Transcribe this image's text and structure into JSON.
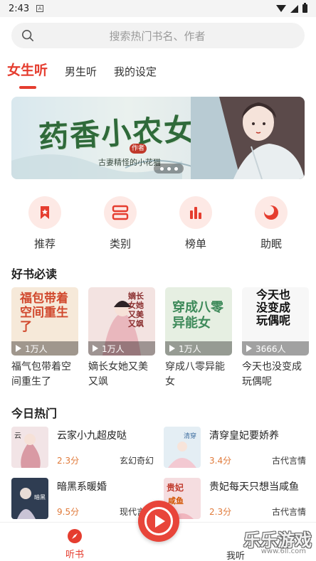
{
  "status_bar": {
    "time": "2:43",
    "sim_label": "A"
  },
  "search": {
    "placeholder": "搜索热门书名、作者"
  },
  "tabs": [
    {
      "label": "女生听",
      "active": true
    },
    {
      "label": "男生听",
      "active": false
    },
    {
      "label": "我的设定",
      "active": false
    }
  ],
  "banner": {
    "title": "药香小农女",
    "author_tag": "作者",
    "author": "古妻精怪的小花猫"
  },
  "quick_actions": [
    {
      "label": "推荐",
      "icon": "bookmark-icon"
    },
    {
      "label": "类别",
      "icon": "category-icon"
    },
    {
      "label": "榜单",
      "icon": "chart-icon"
    },
    {
      "label": "助眠",
      "icon": "moon-icon"
    }
  ],
  "good_books": {
    "title": "好书必读",
    "items": [
      {
        "name": "福气包带着空间重生了",
        "plays": "1万人",
        "cover_text": "福包带着空间重生了",
        "color": "#f6e9d9"
      },
      {
        "name": "嫡长女她又美又飒",
        "plays": "1万人",
        "cover_text": "嫡长女她又美又飒",
        "color": "#f3e3e1"
      },
      {
        "name": "穿成八零异能女",
        "plays": "1万人",
        "cover_text": "穿成八零异能女",
        "color": "#e6efe2"
      },
      {
        "name": "今天也没变成玩偶呢",
        "plays": "3666人",
        "cover_text": "今天也没变成玩偶呢",
        "color": "#f7f7f7"
      }
    ]
  },
  "hot_today": {
    "title": "今日热门",
    "items": [
      {
        "title": "云家小九超皮哒",
        "score": "2.3分",
        "genre": "玄幻奇幻",
        "color": "#f2e4e6"
      },
      {
        "title": "清穿皇妃要娇养",
        "score": "3.4分",
        "genre": "古代言情",
        "color": "#e4eef4"
      },
      {
        "title": "暗黑系暖婚",
        "score": "9.5分",
        "genre": "现代言情",
        "color": "#2f3d52"
      },
      {
        "title": "贵妃每天只想当咸鱼",
        "score": "2.3分",
        "genre": "古代言情",
        "color": "#f5dde0"
      }
    ]
  },
  "bottom_nav": {
    "listen": "听书",
    "mine": "我听"
  },
  "watermark": {
    "text": "乐乐游戏",
    "url": "www.6ll.com"
  },
  "colors": {
    "accent": "#e53d2f",
    "score": "#e07a3a"
  }
}
